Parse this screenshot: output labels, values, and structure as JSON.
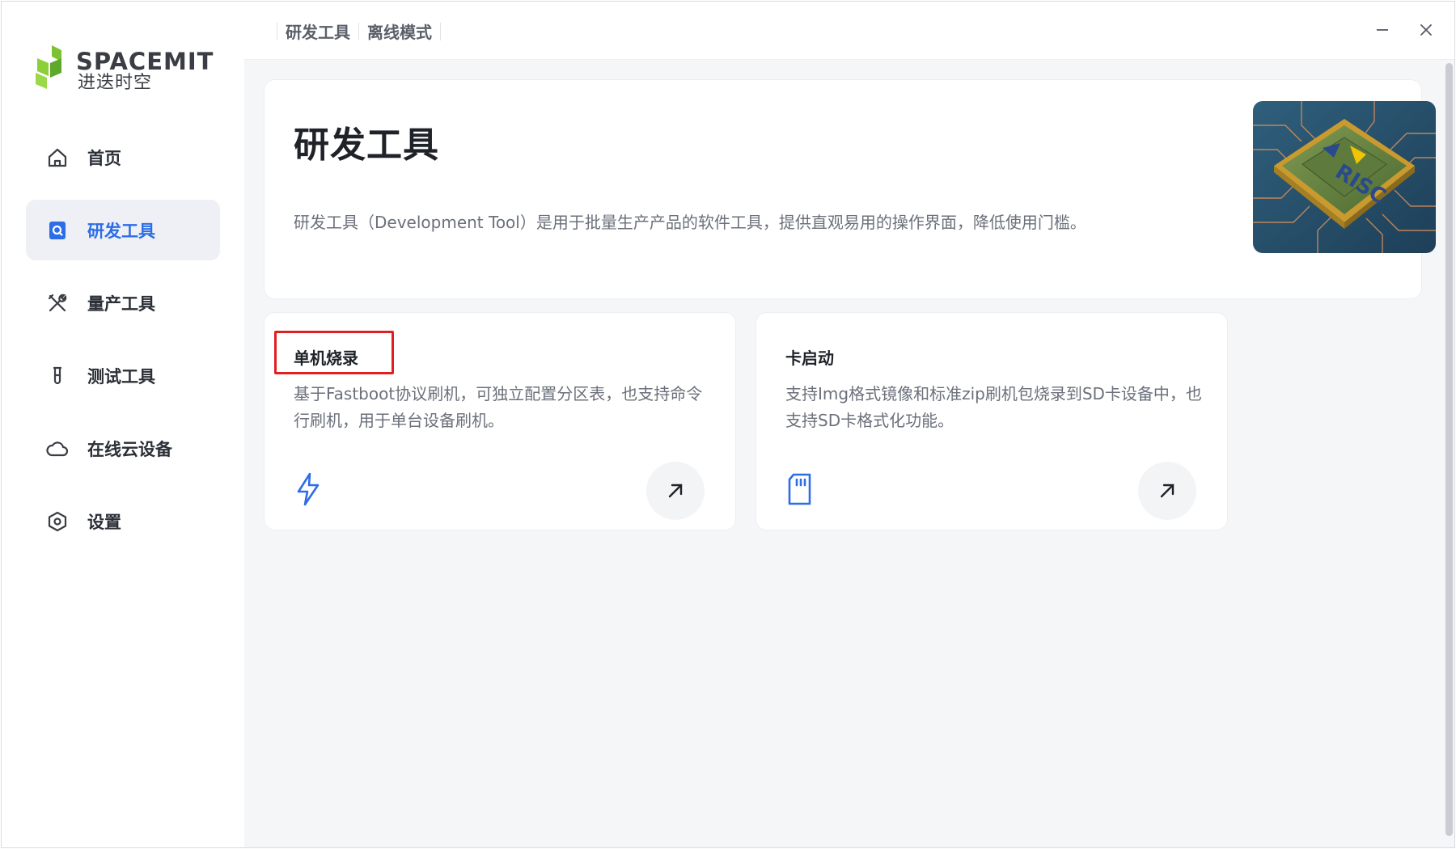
{
  "app": {
    "logo_text_en": "SPACEMIT",
    "logo_text_cn": "进迭时空",
    "brand_green": "#8ccf3a",
    "accent": "#2d6de6"
  },
  "sidebar": {
    "items": [
      {
        "label": "首页",
        "icon": "home-icon",
        "active": false
      },
      {
        "label": "研发工具",
        "icon": "dev-tool-icon",
        "active": true
      },
      {
        "label": "量产工具",
        "icon": "tools-icon",
        "active": false
      },
      {
        "label": "测试工具",
        "icon": "test-tube-icon",
        "active": false
      },
      {
        "label": "在线云设备",
        "icon": "cloud-icon",
        "active": false
      },
      {
        "label": "设置",
        "icon": "settings-icon",
        "active": false
      }
    ]
  },
  "titlebar": {
    "breadcrumbs": [
      "研发工具",
      "离线模式"
    ],
    "minimize_icon": "minimize-icon",
    "close_icon": "close-icon"
  },
  "hero": {
    "title": "研发工具",
    "description": "研发工具（Development Tool）是用于批量生产产品的软件工具，提供直观易用的操作界面，降低使用门槛。",
    "image_icon": "risc-v-chip-image"
  },
  "cards": [
    {
      "title": "单机烧录",
      "description": "基于Fastboot协议刷机，可独立配置分区表，也支持命令行刷机，用于单台设备刷机。",
      "icon": "lightning-icon",
      "highlighted": true
    },
    {
      "title": "卡启动",
      "description": "支持Img格式镜像和标准zip刷机包烧录到SD卡设备中，也支持SD卡格式化功能。",
      "icon": "sd-card-icon",
      "highlighted": false
    }
  ]
}
